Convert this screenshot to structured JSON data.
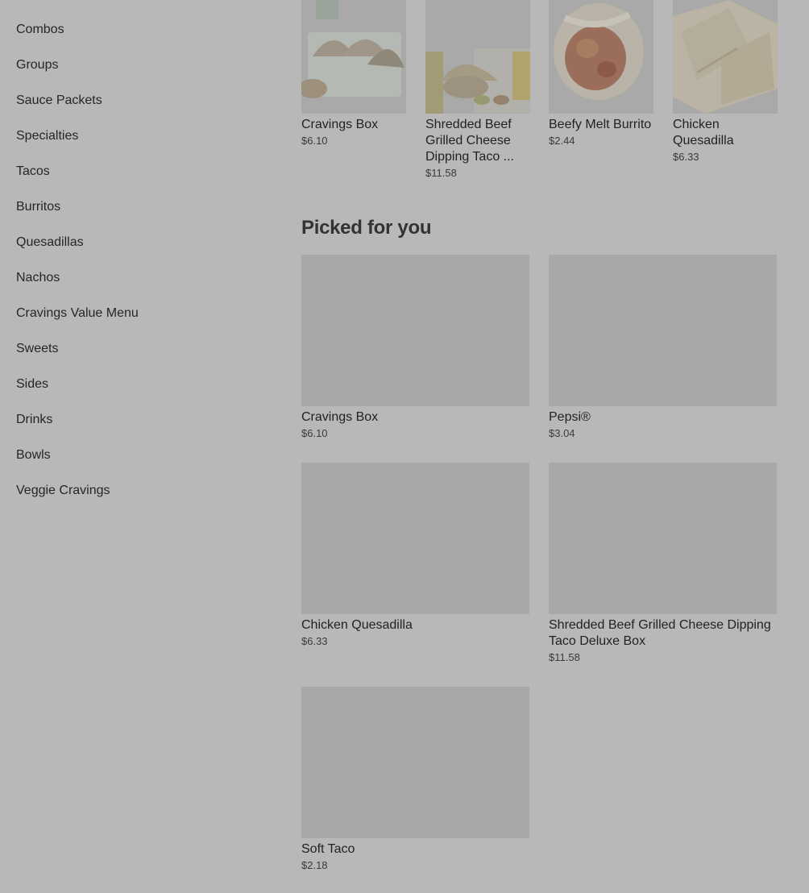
{
  "sidebar": {
    "items": [
      {
        "label": "Combos"
      },
      {
        "label": "Groups"
      },
      {
        "label": "Sauce Packets"
      },
      {
        "label": "Specialties"
      },
      {
        "label": "Tacos"
      },
      {
        "label": "Burritos"
      },
      {
        "label": "Quesadillas"
      },
      {
        "label": "Nachos"
      },
      {
        "label": "Cravings Value Menu"
      },
      {
        "label": "Sweets"
      },
      {
        "label": "Sides"
      },
      {
        "label": "Drinks"
      },
      {
        "label": "Bowls"
      },
      {
        "label": "Veggie Cravings"
      }
    ]
  },
  "featured": {
    "items": [
      {
        "name": "Cravings Box",
        "price": "$6.10"
      },
      {
        "name": "Shredded Beef Grilled Cheese Dipping Taco ...",
        "price": "$11.58"
      },
      {
        "name": "Beefy Melt Burrito",
        "price": "$2.44"
      },
      {
        "name": "Chicken Quesadilla",
        "price": "$6.33"
      }
    ]
  },
  "picked": {
    "title": "Picked for you",
    "items": [
      {
        "name": "Cravings Box",
        "price": "$6.10"
      },
      {
        "name": "Pepsi®",
        "price": "$3.04"
      },
      {
        "name": "Chicken Quesadilla",
        "price": "$6.33"
      },
      {
        "name": "Shredded Beef Grilled Cheese Dipping Taco Deluxe Box",
        "price": "$11.58"
      },
      {
        "name": "Soft Taco",
        "price": "$2.18"
      }
    ]
  },
  "colors": {
    "overlay_background": "#b8b8b8",
    "image_placeholder": "#a8a8a8"
  }
}
